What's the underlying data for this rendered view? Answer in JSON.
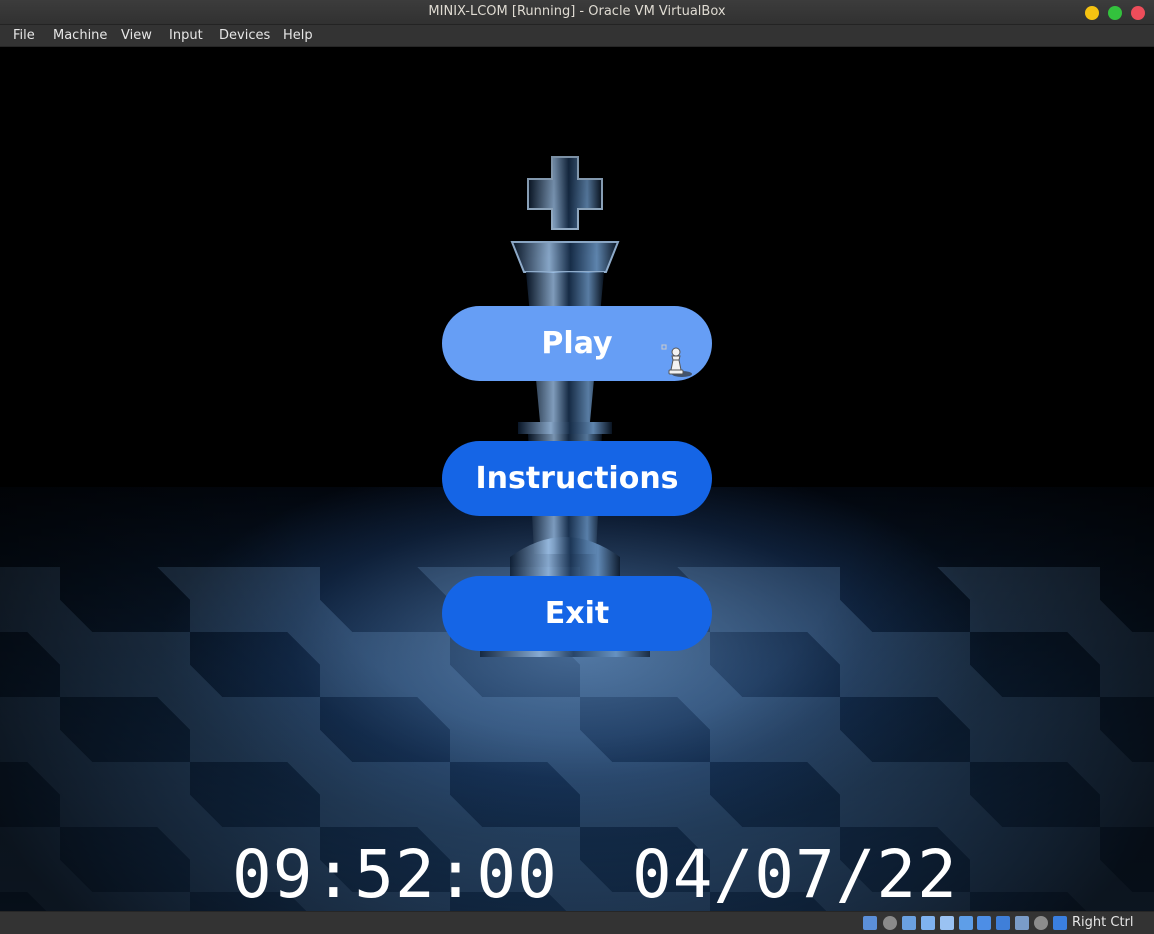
{
  "window": {
    "title": "MINIX-LCOM [Running] - Oracle VM VirtualBox"
  },
  "menubar": {
    "items": [
      {
        "label": "File"
      },
      {
        "label": "Machine"
      },
      {
        "label": "View"
      },
      {
        "label": "Input"
      },
      {
        "label": "Devices"
      },
      {
        "label": "Help"
      }
    ]
  },
  "game_menu": {
    "play_label": "Play",
    "instructions_label": "Instructions",
    "exit_label": "Exit",
    "hovered": "Play"
  },
  "clock": {
    "time": "09:52:00",
    "date": "04/07/22"
  },
  "statusbar": {
    "icons": [
      "hard-disk-icon",
      "optical-drive-icon",
      "audio-icon",
      "network-icon",
      "usb-icon",
      "shared-folders-icon",
      "display-icon",
      "video-capture-icon",
      "cpu-icon",
      "mouse-integration-icon",
      "keyboard-capture-icon"
    ],
    "host_key": "Right Ctrl"
  },
  "colors": {
    "button": "#1565e6",
    "button_hover": "#669ef5",
    "close": "#ed4d5a",
    "minimize": "#f5c211",
    "maximize": "#33c23d"
  }
}
